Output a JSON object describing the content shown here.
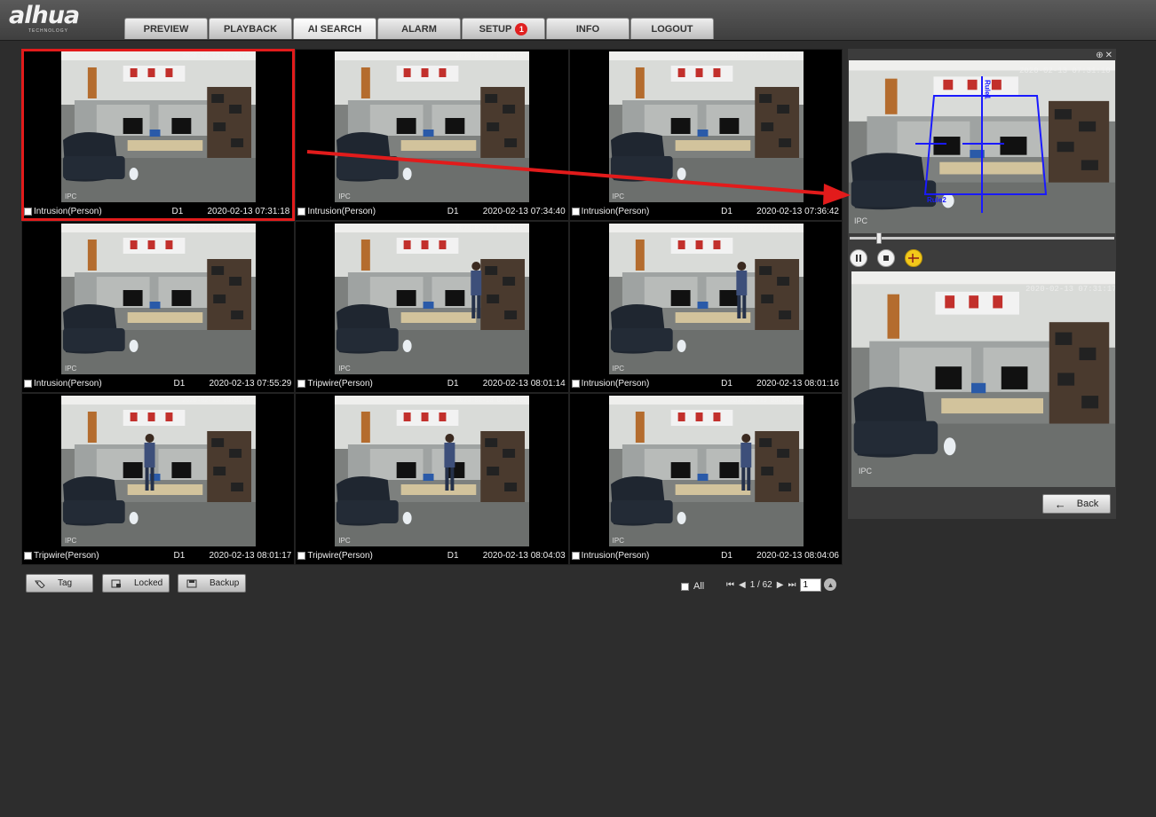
{
  "brand": {
    "name": "alhua",
    "tagline": "TECHNOLOGY"
  },
  "nav": {
    "tabs": [
      {
        "label": "PREVIEW"
      },
      {
        "label": "PLAYBACK"
      },
      {
        "label": "AI SEARCH",
        "active": true
      },
      {
        "label": "ALARM"
      },
      {
        "label": "SETUP",
        "badge": "1"
      },
      {
        "label": "INFO"
      },
      {
        "label": "LOGOUT"
      }
    ]
  },
  "results": [
    {
      "event": "Intrusion(Person)",
      "channel": "D1",
      "time": "2020-02-13 07:31:18",
      "selected": true
    },
    {
      "event": "Intrusion(Person)",
      "channel": "D1",
      "time": "2020-02-13 07:34:40"
    },
    {
      "event": "Intrusion(Person)",
      "channel": "D1",
      "time": "2020-02-13 07:36:42"
    },
    {
      "event": "Intrusion(Person)",
      "channel": "D1",
      "time": "2020-02-13 07:55:29"
    },
    {
      "event": "Tripwire(Person)",
      "channel": "D1",
      "time": "2020-02-13 08:01:14"
    },
    {
      "event": "Intrusion(Person)",
      "channel": "D1",
      "time": "2020-02-13 08:01:16"
    },
    {
      "event": "Tripwire(Person)",
      "channel": "D1",
      "time": "2020-02-13 08:01:17"
    },
    {
      "event": "Tripwire(Person)",
      "channel": "D1",
      "time": "2020-02-13 08:04:03"
    },
    {
      "event": "Intrusion(Person)",
      "channel": "D1",
      "time": "2020-02-13 08:04:06"
    }
  ],
  "cam_label": "IPC",
  "toolbar": {
    "tag_label": "Tag",
    "locked_label": "Locked",
    "backup_label": "Backup",
    "all_label": "All"
  },
  "pagination": {
    "text": "1 / 62",
    "page_value": "1"
  },
  "player": {
    "rule_label": "Rule1",
    "rule2_label": "Rule2",
    "osd_time": "2020-02-13 07:31:10",
    "snapshot_osd": "2020-02-13 07:31:17"
  },
  "back_label": "Back",
  "colors": {
    "highlight": "#e21b1b",
    "rule_line": "#1a1aff",
    "setup_badge": "#e02020"
  }
}
